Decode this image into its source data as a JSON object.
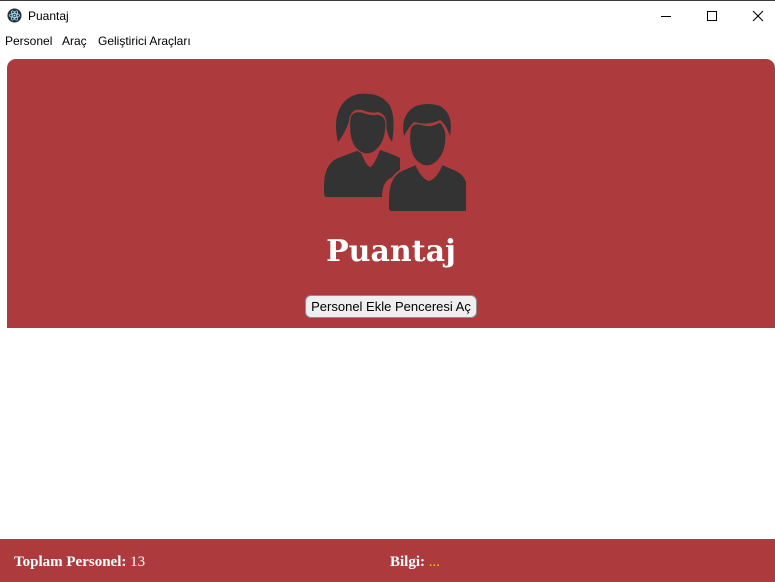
{
  "window": {
    "title": "Puantaj",
    "icon": "electron-app-icon",
    "controls": [
      "minimize-icon",
      "maximize-icon",
      "close-icon"
    ]
  },
  "menu": {
    "items": [
      {
        "label": "Personel"
      },
      {
        "label": "Araç"
      },
      {
        "label": "Geliştirici Araçları"
      }
    ]
  },
  "hero": {
    "icon": "people-icon",
    "title": "Puantaj",
    "button_label": "Personel Ekle Penceresi Aç"
  },
  "footer": {
    "total_label": "Toplam Personel:",
    "total_value": "13",
    "info_label": "Bilgi:",
    "info_value": "..."
  },
  "colors": {
    "accent": "#ad3a3c",
    "info_value": "#f0c419"
  }
}
